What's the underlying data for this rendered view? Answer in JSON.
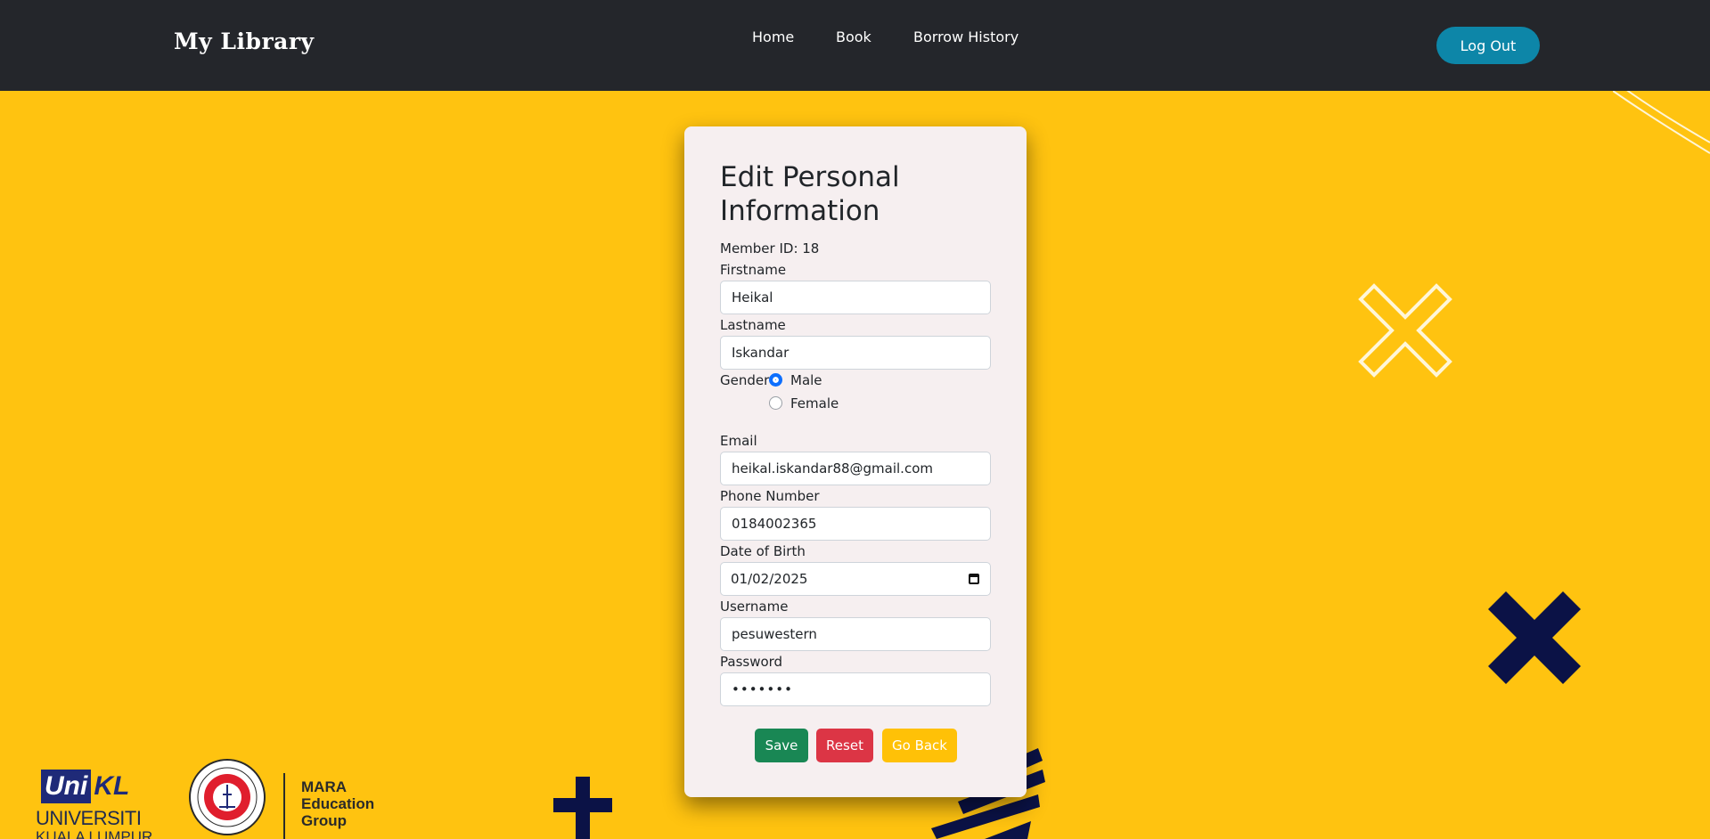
{
  "navbar": {
    "brand": "My Library",
    "links": [
      "Home",
      "Book",
      "Borrow History"
    ],
    "logout_label": "Log Out"
  },
  "form": {
    "title": "Edit Personal Information",
    "member_id": "Member ID: 18",
    "firstname_label": "Firstname",
    "firstname_value": "Heikal",
    "lastname_label": "Lastname",
    "lastname_value": "Iskandar",
    "gender_label": "Gender",
    "gender_options": [
      "Male",
      "Female"
    ],
    "gender_selected": "Male",
    "email_label": "Email",
    "email_value": "heikal.iskandar88@gmail.com",
    "phone_label": "Phone Number",
    "phone_value": "0184002365",
    "dob_label": "Date of Birth",
    "dob_value": "01/02/2025",
    "username_label": "Username",
    "username_value": "pesuwestern",
    "password_label": "Password",
    "password_value": "•••••••",
    "buttons": {
      "save": "Save",
      "reset": "Reset",
      "back": "Go Back"
    }
  },
  "footer_logos": {
    "unikl_top_uni": "Uni",
    "unikl_top_kl": "KL",
    "unikl_line1": "UNIVERSITI",
    "unikl_line2": "KUALA LUMPUR",
    "mara_line1": "MARA",
    "mara_line2": "Education",
    "mara_line3": "Group"
  },
  "colors": {
    "background": "#ffc310",
    "navbar": "#24262b",
    "logout": "#0d86a8",
    "save": "#198754",
    "reset": "#dc3545",
    "back": "#ffc107",
    "navy_shape": "#0b1246"
  }
}
